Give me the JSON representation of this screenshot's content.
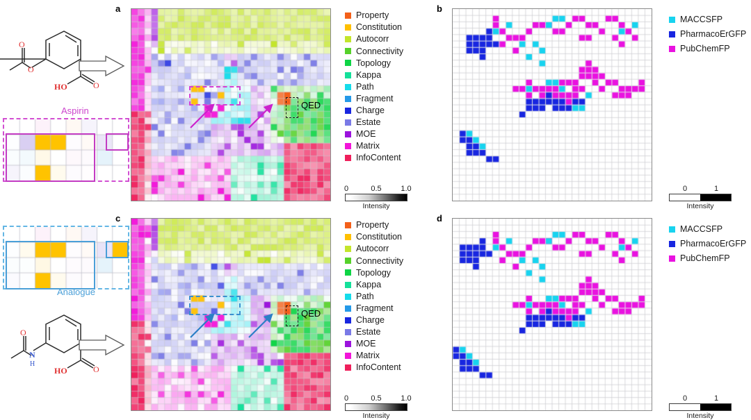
{
  "figure": {
    "panels": [
      {
        "letter": "a"
      },
      {
        "letter": "b"
      },
      {
        "letter": "c"
      },
      {
        "letter": "d"
      }
    ]
  },
  "molecules": {
    "top": {
      "name": "Aspirin",
      "name_color": "#cc44cc",
      "atom_labels": [
        "O",
        "O",
        "O",
        "HO",
        "O"
      ]
    },
    "bottom": {
      "name": "Analogue",
      "name_color": "#4a9fd8",
      "atom_labels": [
        "O",
        "N",
        "H",
        "HO",
        "O"
      ]
    }
  },
  "descriptor_legend": {
    "items": [
      {
        "label": "Property",
        "color": "#f3601a"
      },
      {
        "label": "Constitution",
        "color": "#ffc000"
      },
      {
        "label": "Autocorr",
        "color": "#c3e52b"
      },
      {
        "label": "Connectivity",
        "color": "#56d12a"
      },
      {
        "label": "Topology",
        "color": "#0ed445"
      },
      {
        "label": "Kappa",
        "color": "#14e09a"
      },
      {
        "label": "Path",
        "color": "#15dcea"
      },
      {
        "label": "Fragment",
        "color": "#2499e8"
      },
      {
        "label": "Charge",
        "color": "#1826e0"
      },
      {
        "label": "Estate",
        "color": "#7a7ae6"
      },
      {
        "label": "MOE",
        "color": "#9b13dd"
      },
      {
        "label": "Matrix",
        "color": "#f215d9"
      },
      {
        "label": "InfoContent",
        "color": "#ef1f5b"
      }
    ]
  },
  "fingerprint_legend": {
    "items": [
      {
        "label": "MACCSFP",
        "color": "#18d3ef"
      },
      {
        "label": "PharmacoErGFP",
        "color": "#1826e0"
      },
      {
        "label": "PubChemFP",
        "color": "#e912e0"
      }
    ]
  },
  "colorbars": {
    "intensity_continuous": {
      "ticks": [
        "0",
        "0.5",
        "1.0"
      ],
      "caption": "Intensity"
    },
    "intensity_binary": {
      "ticks": [
        "0",
        "1"
      ],
      "caption": "Intensity"
    }
  },
  "annotations": {
    "qed_label": "QED"
  },
  "chart_data": {
    "type": "heatmap",
    "title": "",
    "description": "Self-organizing map (SOM) component planes coloured by molecular descriptor family; panels a and c show descriptor activations for Aspirin and its Analogue, panels b and d show binary fingerprint activations.",
    "grid": {
      "cols": 30,
      "rows": 30
    },
    "panels": {
      "a": {
        "label": "a",
        "colormap": "descriptor-family",
        "intensity_range": [
          0,
          1
        ]
      },
      "b": {
        "label": "b",
        "colormap": "fingerprint-binary",
        "intensity_range": [
          0,
          1
        ]
      },
      "c": {
        "label": "c",
        "colormap": "descriptor-family",
        "intensity_range": [
          0,
          1
        ]
      },
      "d": {
        "label": "d",
        "colormap": "fingerprint-binary",
        "intensity_range": [
          0,
          1
        ]
      }
    },
    "inset_a": {
      "rows": 4,
      "cols": 8,
      "border_color": "#cc44cc",
      "values": [
        [
          0.0,
          0.0,
          0.18,
          0.0,
          0.12,
          0.1,
          0.0,
          0.0
        ],
        [
          0.02,
          0.45,
          0.95,
          0.95,
          0.06,
          0.1,
          0.22,
          0.0
        ],
        [
          0.08,
          0.14,
          0.07,
          0.0,
          0.1,
          0.1,
          0.55,
          0.0
        ],
        [
          0.1,
          0.06,
          0.8,
          0.05,
          0.05,
          0.03,
          0.0,
          0.0
        ]
      ]
    },
    "inset_c": {
      "rows": 4,
      "cols": 8,
      "border_color": "#4a9fd8",
      "values": [
        [
          0.0,
          0.0,
          0.18,
          0.0,
          0.12,
          0.1,
          0.0,
          0.0
        ],
        [
          0.02,
          0.05,
          0.95,
          0.92,
          0.07,
          0.1,
          0.24,
          0.85
        ],
        [
          0.06,
          0.04,
          0.08,
          0.0,
          0.05,
          0.1,
          0.55,
          0.0
        ],
        [
          0.04,
          0.03,
          0.85,
          0.05,
          0.05,
          0.03,
          0.0,
          0.0
        ]
      ]
    }
  }
}
